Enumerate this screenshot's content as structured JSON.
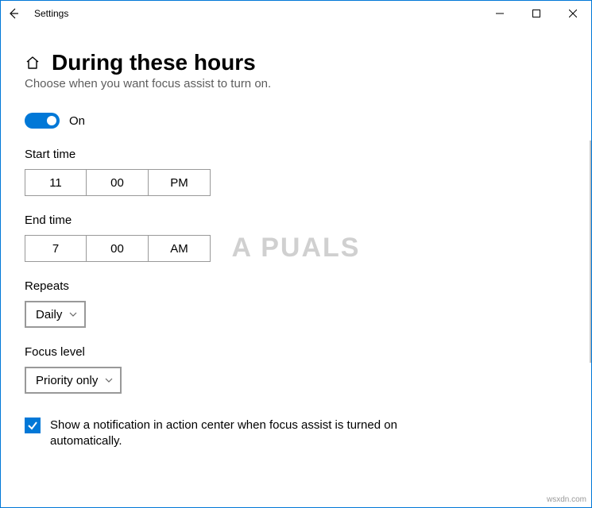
{
  "window": {
    "title": "Settings"
  },
  "page": {
    "heading": "During these hours",
    "subtitle": "Choose when you want focus assist to turn on."
  },
  "toggle": {
    "state_label": "On"
  },
  "start_time": {
    "label": "Start time",
    "hour": "11",
    "minute": "00",
    "ampm": "PM"
  },
  "end_time": {
    "label": "End time",
    "hour": "7",
    "minute": "00",
    "ampm": "AM"
  },
  "repeats": {
    "label": "Repeats",
    "value": "Daily"
  },
  "focus_level": {
    "label": "Focus level",
    "value": "Priority only"
  },
  "checkbox": {
    "label": "Show a notification in action center when focus assist is turned on automatically."
  },
  "watermark": "A   PUALS",
  "sourcemark": "wsxdn.com"
}
